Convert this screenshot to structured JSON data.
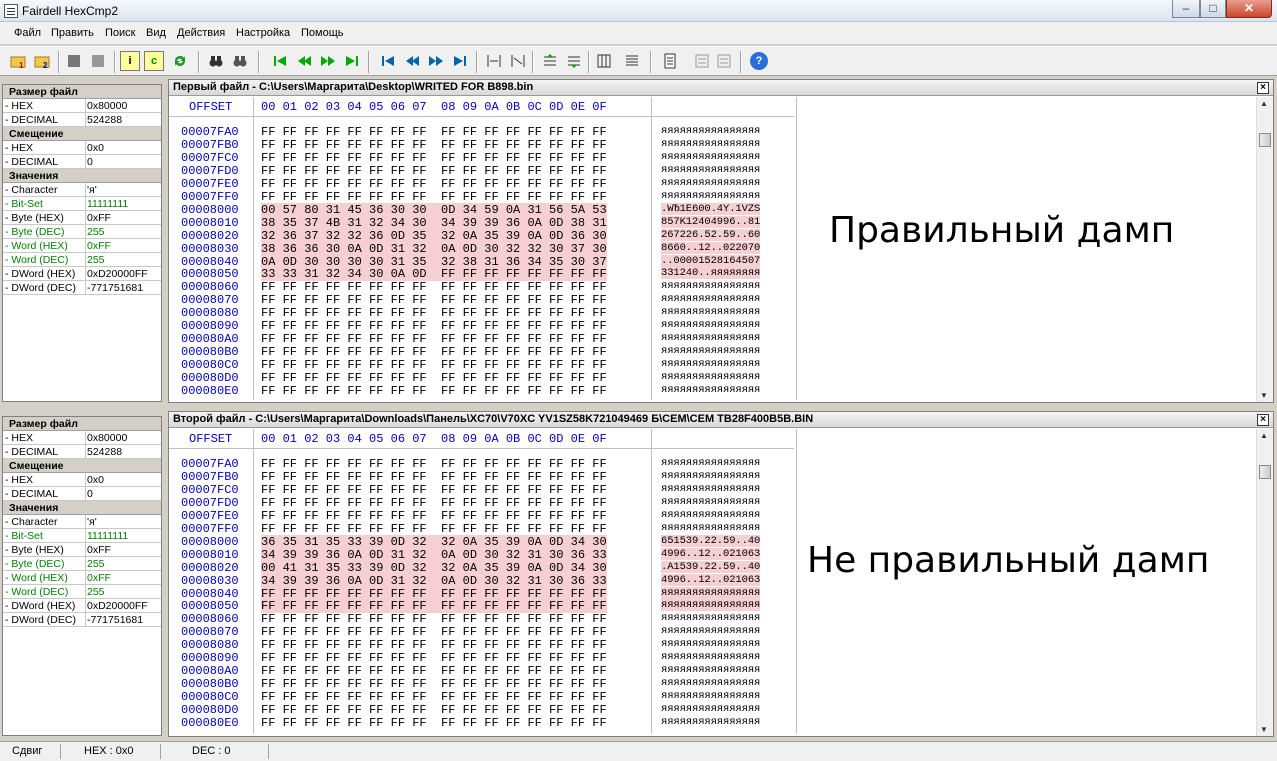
{
  "window": {
    "title": "Fairdell HexCmp2",
    "min": "–",
    "max": "□",
    "close": "✕"
  },
  "menu": [
    "Файл",
    "Править",
    "Поиск",
    "Вид",
    "Действия",
    "Настройка",
    "Помощь"
  ],
  "toolbar": {
    "info_label": "i",
    "compare_label": "c",
    "help_label": "?"
  },
  "props_labels": {
    "size": "Размер файл",
    "hex": " - HEX",
    "decimal": " - DECIMAL",
    "offset": "Смещение",
    "values": "Значения",
    "character": " - Character",
    "bitset": " - Bit-Set",
    "byte_hex": " - Byte (HEX)",
    "byte_dec": " - Byte (DEC)",
    "word_hex": " - Word (HEX)",
    "word_dec": " - Word (DEC)",
    "dword_hex": " - DWord (HEX)",
    "dword_dec": " - DWord (DEC)"
  },
  "props": {
    "size_hex": "0x80000",
    "size_dec": "524288",
    "offset_hex": "0x0",
    "offset_dec": "0",
    "character": "'я'",
    "bitset": "11111111",
    "byte_hex": "0xFF",
    "byte_dec": "255",
    "word_hex": "0xFF",
    "word_dec": "255",
    "dword_hex": "0xD20000FF",
    "dword_dec": "-771751681"
  },
  "hex_header": {
    "offset": "OFFSET",
    "cols": "00 01 02 03 04 05 06 07  08 09 0A 0B 0C 0D 0E 0F"
  },
  "pane1": {
    "title": "Первый файл - C:\\Users\\Маргарита\\Desktop\\WRITED FOR B898.bin",
    "annotation": "Правильный дамп",
    "rows": [
      {
        "off": "00007FA0",
        "hex": "FF FF FF FF FF FF FF FF  FF FF FF FF FF FF FF FF",
        "asc": "яяяяяяяяяяяяяяяя",
        "hl": false
      },
      {
        "off": "00007FB0",
        "hex": "FF FF FF FF FF FF FF FF  FF FF FF FF FF FF FF FF",
        "asc": "яяяяяяяяяяяяяяяя",
        "hl": false
      },
      {
        "off": "00007FC0",
        "hex": "FF FF FF FF FF FF FF FF  FF FF FF FF FF FF FF FF",
        "asc": "яяяяяяяяяяяяяяяя",
        "hl": false
      },
      {
        "off": "00007FD0",
        "hex": "FF FF FF FF FF FF FF FF  FF FF FF FF FF FF FF FF",
        "asc": "яяяяяяяяяяяяяяяя",
        "hl": false
      },
      {
        "off": "00007FE0",
        "hex": "FF FF FF FF FF FF FF FF  FF FF FF FF FF FF FF FF",
        "asc": "яяяяяяяяяяяяяяяя",
        "hl": false
      },
      {
        "off": "00007FF0",
        "hex": "FF FF FF FF FF FF FF FF  FF FF FF FF FF FF FF FF",
        "asc": "яяяяяяяяяяяяяяяя",
        "hl": false
      },
      {
        "off": "00008000",
        "hex": "00 57 80 31 45 36 30 30  0D 34 59 0A 31 56 5A 53",
        "asc": ".WЂ1E600.4Y.1VZS",
        "hl": true
      },
      {
        "off": "00008010",
        "hex": "38 35 37 4B 31 32 34 30  34 39 39 36 0A 0D 38 31",
        "asc": "857K12404996..81",
        "hl": true
      },
      {
        "off": "00008020",
        "hex": "32 36 37 32 32 36 0D 35  32 0A 35 39 0A 0D 36 30",
        "asc": "267226.52.59..60",
        "hl": true
      },
      {
        "off": "00008030",
        "hex": "38 36 36 30 0A 0D 31 32  0A 0D 30 32 32 30 37 30",
        "asc": "8660..12..022070",
        "hl": true
      },
      {
        "off": "00008040",
        "hex": "0A 0D 30 30 30 30 31 35  32 38 31 36 34 35 30 37",
        "asc": "..00001528164507",
        "hl": true
      },
      {
        "off": "00008050",
        "hex": "33 33 31 32 34 30 0A 0D  FF FF FF FF FF FF FF FF",
        "asc": "331240..яяяяяяяя",
        "hl": true
      },
      {
        "off": "00008060",
        "hex": "FF FF FF FF FF FF FF FF  FF FF FF FF FF FF FF FF",
        "asc": "яяяяяяяяяяяяяяяя",
        "hl": false
      },
      {
        "off": "00008070",
        "hex": "FF FF FF FF FF FF FF FF  FF FF FF FF FF FF FF FF",
        "asc": "яяяяяяяяяяяяяяяя",
        "hl": false
      },
      {
        "off": "00008080",
        "hex": "FF FF FF FF FF FF FF FF  FF FF FF FF FF FF FF FF",
        "asc": "яяяяяяяяяяяяяяяя",
        "hl": false
      },
      {
        "off": "00008090",
        "hex": "FF FF FF FF FF FF FF FF  FF FF FF FF FF FF FF FF",
        "asc": "яяяяяяяяяяяяяяяя",
        "hl": false
      },
      {
        "off": "000080A0",
        "hex": "FF FF FF FF FF FF FF FF  FF FF FF FF FF FF FF FF",
        "asc": "яяяяяяяяяяяяяяяя",
        "hl": false
      },
      {
        "off": "000080B0",
        "hex": "FF FF FF FF FF FF FF FF  FF FF FF FF FF FF FF FF",
        "asc": "яяяяяяяяяяяяяяяя",
        "hl": false
      },
      {
        "off": "000080C0",
        "hex": "FF FF FF FF FF FF FF FF  FF FF FF FF FF FF FF FF",
        "asc": "яяяяяяяяяяяяяяяя",
        "hl": false
      },
      {
        "off": "000080D0",
        "hex": "FF FF FF FF FF FF FF FF  FF FF FF FF FF FF FF FF",
        "asc": "яяяяяяяяяяяяяяяя",
        "hl": false
      },
      {
        "off": "000080E0",
        "hex": "FF FF FF FF FF FF FF FF  FF FF FF FF FF FF FF FF",
        "asc": "яяяяяяяяяяяяяяяя",
        "hl": false
      }
    ]
  },
  "pane2": {
    "title": "Второй файл - C:\\Users\\Маргарита\\Downloads\\Панель\\XC70\\V70XC YV1SZ58K721049469 Б\\CEM\\CEM TB28F400B5B.BIN",
    "annotation": "Не правильный дамп",
    "rows": [
      {
        "off": "00007FA0",
        "hex": "FF FF FF FF FF FF FF FF  FF FF FF FF FF FF FF FF",
        "asc": "яяяяяяяяяяяяяяяя",
        "hl": false
      },
      {
        "off": "00007FB0",
        "hex": "FF FF FF FF FF FF FF FF  FF FF FF FF FF FF FF FF",
        "asc": "яяяяяяяяяяяяяяяя",
        "hl": false
      },
      {
        "off": "00007FC0",
        "hex": "FF FF FF FF FF FF FF FF  FF FF FF FF FF FF FF FF",
        "asc": "яяяяяяяяяяяяяяяя",
        "hl": false
      },
      {
        "off": "00007FD0",
        "hex": "FF FF FF FF FF FF FF FF  FF FF FF FF FF FF FF FF",
        "asc": "яяяяяяяяяяяяяяяя",
        "hl": false
      },
      {
        "off": "00007FE0",
        "hex": "FF FF FF FF FF FF FF FF  FF FF FF FF FF FF FF FF",
        "asc": "яяяяяяяяяяяяяяяя",
        "hl": false
      },
      {
        "off": "00007FF0",
        "hex": "FF FF FF FF FF FF FF FF  FF FF FF FF FF FF FF FF",
        "asc": "яяяяяяяяяяяяяяяя",
        "hl": false
      },
      {
        "off": "00008000",
        "hex": "36 35 31 35 33 39 0D 32  32 0A 35 39 0A 0D 34 30",
        "asc": "651539.22.59..40",
        "hl": true
      },
      {
        "off": "00008010",
        "hex": "34 39 39 36 0A 0D 31 32  0A 0D 30 32 31 30 36 33",
        "asc": "4996..12..021063",
        "hl": true
      },
      {
        "off": "00008020",
        "hex": "00 41 31 35 33 39 0D 32  32 0A 35 39 0A 0D 34 30",
        "asc": ".A1539.22.59..40",
        "hl": true
      },
      {
        "off": "00008030",
        "hex": "34 39 39 36 0A 0D 31 32  0A 0D 30 32 31 30 36 33",
        "asc": "4996..12..021063",
        "hl": true
      },
      {
        "off": "00008040",
        "hex": "FF FF FF FF FF FF FF FF  FF FF FF FF FF FF FF FF",
        "asc": "яяяяяяяяяяяяяяяя",
        "hl": true
      },
      {
        "off": "00008050",
        "hex": "FF FF FF FF FF FF FF FF  FF FF FF FF FF FF FF FF",
        "asc": "яяяяяяяяяяяяяяяя",
        "hl": true
      },
      {
        "off": "00008060",
        "hex": "FF FF FF FF FF FF FF FF  FF FF FF FF FF FF FF FF",
        "asc": "яяяяяяяяяяяяяяяя",
        "hl": false
      },
      {
        "off": "00008070",
        "hex": "FF FF FF FF FF FF FF FF  FF FF FF FF FF FF FF FF",
        "asc": "яяяяяяяяяяяяяяяя",
        "hl": false
      },
      {
        "off": "00008080",
        "hex": "FF FF FF FF FF FF FF FF  FF FF FF FF FF FF FF FF",
        "asc": "яяяяяяяяяяяяяяяя",
        "hl": false
      },
      {
        "off": "00008090",
        "hex": "FF FF FF FF FF FF FF FF  FF FF FF FF FF FF FF FF",
        "asc": "яяяяяяяяяяяяяяяя",
        "hl": false
      },
      {
        "off": "000080A0",
        "hex": "FF FF FF FF FF FF FF FF  FF FF FF FF FF FF FF FF",
        "asc": "яяяяяяяяяяяяяяяя",
        "hl": false
      },
      {
        "off": "000080B0",
        "hex": "FF FF FF FF FF FF FF FF  FF FF FF FF FF FF FF FF",
        "asc": "яяяяяяяяяяяяяяяя",
        "hl": false
      },
      {
        "off": "000080C0",
        "hex": "FF FF FF FF FF FF FF FF  FF FF FF FF FF FF FF FF",
        "asc": "яяяяяяяяяяяяяяяя",
        "hl": false
      },
      {
        "off": "000080D0",
        "hex": "FF FF FF FF FF FF FF FF  FF FF FF FF FF FF FF FF",
        "asc": "яяяяяяяяяяяяяяяя",
        "hl": false
      },
      {
        "off": "000080E0",
        "hex": "FF FF FF FF FF FF FF FF  FF FF FF FF FF FF FF FF",
        "asc": "яяяяяяяяяяяяяяяя",
        "hl": false
      }
    ]
  },
  "status": {
    "shift": "Сдвиг",
    "hex": "HEX : 0x0",
    "dec": "DEC : 0"
  }
}
